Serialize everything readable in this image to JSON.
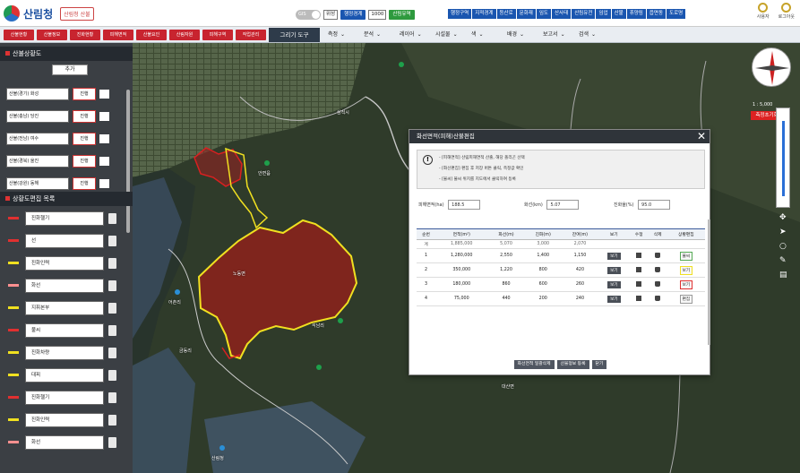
{
  "header": {
    "logo_text": "산림청",
    "badge": "산림청 산불",
    "toggle": "GIS",
    "select1": "위성",
    "select2": "1000",
    "pill_blue": "행정경계",
    "pill_green": "산림유역",
    "menu": [
      "행정구역",
      "지적경계",
      "등산로",
      "문화재",
      "임도",
      "산사태",
      "산림유전",
      "임업",
      "산불",
      "휴양림",
      "읍면동",
      "도로명"
    ],
    "icons": [
      {
        "name": "user-icon",
        "label": "사용자"
      },
      {
        "name": "power-icon",
        "label": "로그아웃"
      }
    ]
  },
  "toolbar": {
    "red_buttons": [
      "산불현황",
      "산불정보",
      "진화현황",
      "피해면적",
      "산불요인",
      "산림자원",
      "피해구역",
      "작업관리"
    ],
    "main_tool": "그리기 도구",
    "menus": [
      "측정",
      "분석",
      "레이어",
      "시설물",
      "색",
      "배경",
      "보고서",
      "검색"
    ]
  },
  "left": {
    "sec1_title": "산불상황도",
    "sec1_button": "추가",
    "layers": [
      {
        "name": "산불(경기) 화성",
        "tag": "진행"
      },
      {
        "name": "산불(충남) 당진",
        "tag": "진행"
      },
      {
        "name": "산불(전남) 여수",
        "tag": "진행"
      },
      {
        "name": "산불(경북) 울진",
        "tag": "진행"
      },
      {
        "name": "산불(강원) 동해",
        "tag": "진행"
      }
    ],
    "sec2_title": "상황도편집 목록",
    "styles": [
      {
        "name": "진화헬기",
        "color": "#e03030"
      },
      {
        "name": "선",
        "color": "#e03030"
      },
      {
        "name": "진화인력",
        "color": "#f0e020"
      },
      {
        "name": "화선",
        "color": "#ff9090"
      },
      {
        "name": "지휘본부",
        "color": "#f0e020"
      },
      {
        "name": "불씨",
        "color": "#e03030"
      },
      {
        "name": "진화차량",
        "color": "#f0e020"
      },
      {
        "name": "대피",
        "color": "#f0e020"
      },
      {
        "name": "진화헬기",
        "color": "#e03030"
      },
      {
        "name": "진화인력",
        "color": "#f0e020"
      },
      {
        "name": "화선",
        "color": "#ff9090"
      }
    ]
  },
  "map": {
    "labels": [
      "삼척시",
      "안면읍",
      "노동면",
      "어촌리",
      "석남리",
      "금동리",
      "대산면",
      "산림청"
    ],
    "scale": "1 : 5,000",
    "red_badge": "측정초기화"
  },
  "dialog": {
    "title": "화선면적(피해)산불편집",
    "notes": [
      "- [피해면적] 산림피해면적 산출, 해당 폴리곤 선택",
      "- [화선편집] 편집 후 저장 버튼 클릭, 측정값 확인",
      "- [불씨] 불씨 위치를 지도에서 클릭하여 등록"
    ],
    "form": {
      "f1_label": "피해면적(ha)",
      "f1_value": "188.5",
      "f2_label": "화선(km)",
      "f2_value": "5.07",
      "f3_label": "진화율(%)",
      "f3_value": "95.0"
    },
    "table": {
      "headers": [
        "순번",
        "면적(m²)",
        "화선(m)",
        "진화(m)",
        "잔여(m)",
        "보기",
        "수정",
        "삭제",
        "상황편집"
      ],
      "sum": [
        "계",
        "1,885,000",
        "5,070",
        "3,000",
        "2,070",
        "",
        "",
        "",
        ""
      ],
      "rows": [
        {
          "no": "1",
          "area": "1,280,000",
          "line": "2,550",
          "done": "1,400",
          "left": "1,150",
          "view": "보기",
          "act": "불씨",
          "mark": "#5a5"
        },
        {
          "no": "2",
          "area": "350,000",
          "line": "1,220",
          "done": "800",
          "left": "420",
          "view": "보기",
          "act": "보기",
          "mark": "#f0e020"
        },
        {
          "no": "3",
          "area": "180,000",
          "line": "860",
          "done": "600",
          "left": "260",
          "view": "보기",
          "act": "보기",
          "mark": "#e03030"
        },
        {
          "no": "4",
          "area": "75,000",
          "line": "440",
          "done": "200",
          "left": "240",
          "view": "보기",
          "act": "편집",
          "mark": "#999"
        }
      ]
    },
    "footer": [
      "화선면적 일괄삭제",
      "산불정보 등록",
      "닫기"
    ]
  }
}
